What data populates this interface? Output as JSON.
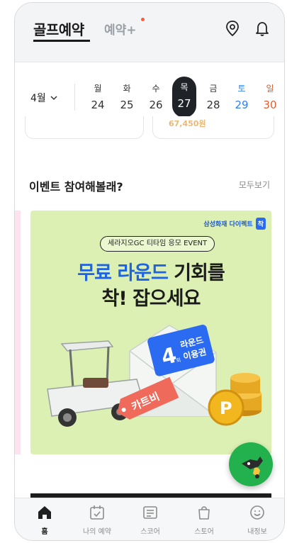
{
  "header": {
    "tab_golf": "골프예약",
    "tab_plus": "예약+"
  },
  "date_strip": {
    "month": "4월",
    "days": [
      {
        "dow": "월",
        "num": "24",
        "type": "weekday"
      },
      {
        "dow": "화",
        "num": "25",
        "type": "weekday"
      },
      {
        "dow": "수",
        "num": "26",
        "type": "weekday"
      },
      {
        "dow": "목",
        "num": "27",
        "type": "selected"
      },
      {
        "dow": "금",
        "num": "28",
        "type": "weekday"
      },
      {
        "dow": "토",
        "num": "29",
        "type": "sat"
      },
      {
        "dow": "일",
        "num": "30",
        "type": "sun"
      }
    ]
  },
  "card_remnant_text": "67,450원",
  "event": {
    "title": "이벤트 참여해볼래?",
    "more": "모두보기"
  },
  "banner": {
    "sponsor": "삼성화재 다이렉트",
    "sponsor_badge": "착",
    "pill": "세라지오GC 티타임 응모 EVENT",
    "headline1_blue": "무료 라운드",
    "headline1_dark": " 기회를",
    "headline2": "착! 잡으세요",
    "ticket_number": "4",
    "ticket_unit": "회",
    "ticket_line1": "라운드",
    "ticket_line2": "이용권",
    "cart_tag": "카트비",
    "coin_letter": "P"
  },
  "bottom_nav": [
    {
      "label": "홈",
      "icon": "home-icon"
    },
    {
      "label": "나의 예약",
      "icon": "calendar-check-icon"
    },
    {
      "label": "스코어",
      "icon": "scorecard-icon"
    },
    {
      "label": "스토어",
      "icon": "shopping-bag-icon"
    },
    {
      "label": "내정보",
      "icon": "smile-face-icon"
    }
  ],
  "colors": {
    "selected_day": "#1f2328",
    "saturday": "#2f80ed",
    "sunday": "#e65c2b",
    "banner_bg": "#dcf0b4",
    "headline_blue": "#1c63e6",
    "fab_green": "#22b14c"
  }
}
